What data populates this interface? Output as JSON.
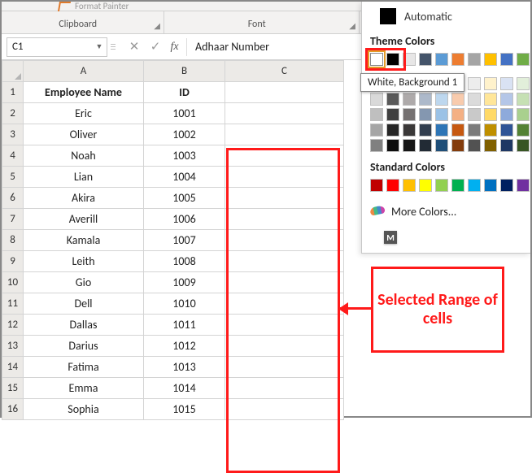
{
  "ribbon": {
    "format_painter_label": "Format Painter",
    "group_clipboard": "Clipboard",
    "group_font": "Font"
  },
  "formula_bar": {
    "namebox_value": "C1",
    "cancel_glyph": "✕",
    "accept_glyph": "✓",
    "fx_label": "fx",
    "formula_value": "Adhaar Number"
  },
  "columns": [
    "A",
    "B",
    "C"
  ],
  "row_numbers": [
    1,
    2,
    3,
    4,
    5,
    6,
    7,
    8,
    9,
    10,
    11,
    12,
    13,
    14,
    15,
    16
  ],
  "headers": {
    "a": "Employee Name",
    "b": "ID"
  },
  "rows": [
    {
      "a": "Eric",
      "b": "1001"
    },
    {
      "a": "Oliver",
      "b": "1002"
    },
    {
      "a": "Noah",
      "b": "1003"
    },
    {
      "a": "Lian",
      "b": "1004"
    },
    {
      "a": "Akira",
      "b": "1005"
    },
    {
      "a": "Averill",
      "b": "1006"
    },
    {
      "a": "Kamala",
      "b": "1007"
    },
    {
      "a": "Leith",
      "b": "1008"
    },
    {
      "a": "Gio",
      "b": "1009"
    },
    {
      "a": "Dell",
      "b": "1010"
    },
    {
      "a": "Dallas",
      "b": "1011"
    },
    {
      "a": "Darius",
      "b": "1012"
    },
    {
      "a": "Fatima",
      "b": "1013"
    },
    {
      "a": "Emma",
      "b": "1014"
    },
    {
      "a": "Sophia",
      "b": "1015"
    }
  ],
  "color_picker": {
    "automatic_label": "Automatic",
    "theme_header": "Theme Colors",
    "tooltip_text": "White, Background 1",
    "theme_top": [
      "#ffffff",
      "#000000",
      "#e7e6e6",
      "#44546a",
      "#5b9bd5",
      "#ed7d31",
      "#a5a5a5",
      "#ffc000",
      "#4472c4",
      "#70ad47"
    ],
    "theme_tints": [
      [
        "#f2f2f2",
        "#7f7f7f",
        "#d0cece",
        "#d6dce4",
        "#deebf6",
        "#fce4d6",
        "#ededed",
        "#fff2cc",
        "#d9e2f3",
        "#e2efda"
      ],
      [
        "#d9d9d9",
        "#595959",
        "#aeaaaa",
        "#adb9ca",
        "#bdd7ee",
        "#f8cbad",
        "#dbdbdb",
        "#ffe699",
        "#b4c6e7",
        "#c6e0b4"
      ],
      [
        "#bfbfbf",
        "#404040",
        "#757171",
        "#8497b0",
        "#9bc2e6",
        "#f4b084",
        "#c9c9c9",
        "#ffd966",
        "#8eaadb",
        "#a9d08e"
      ],
      [
        "#a6a6a6",
        "#262626",
        "#3a3838",
        "#333f4f",
        "#2e75b6",
        "#c65911",
        "#7b7b7b",
        "#bf8f00",
        "#2f5496",
        "#548235"
      ],
      [
        "#808080",
        "#0d0d0d",
        "#161616",
        "#222b35",
        "#1f4e78",
        "#833c0c",
        "#525252",
        "#806000",
        "#1f3864",
        "#375623"
      ]
    ],
    "standard_header": "Standard Colors",
    "standard": [
      "#c00000",
      "#ff0000",
      "#ffc000",
      "#ffff00",
      "#92d050",
      "#00b050",
      "#00b0f0",
      "#0070c0",
      "#002060",
      "#7030a0"
    ],
    "more_colors_label": "More Colors...",
    "more_badge": "M"
  },
  "annotation": {
    "text": "Selected Range of cells"
  }
}
